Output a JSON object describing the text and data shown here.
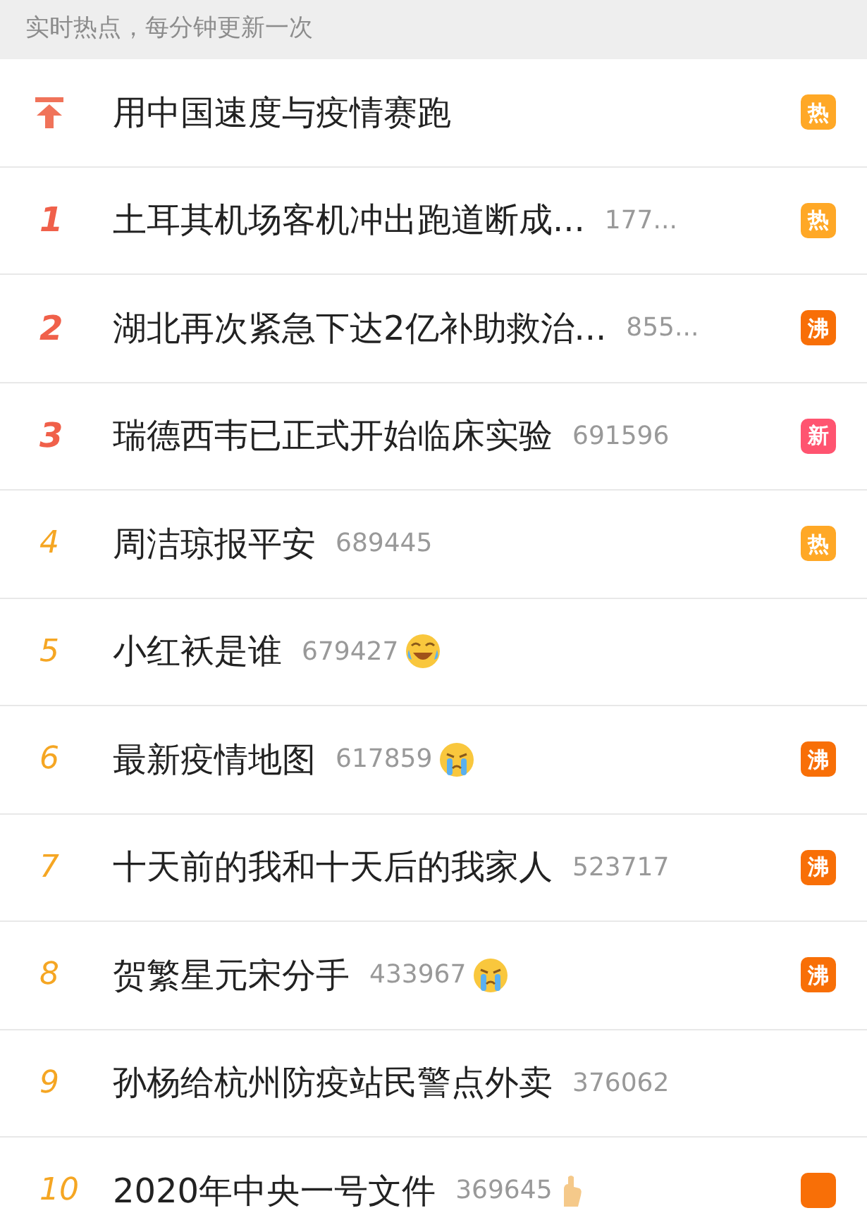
{
  "header": {
    "text": "实时热点，每分钟更新一次"
  },
  "items": [
    {
      "kind": "pinned",
      "title": "用中国速度与疫情赛跑",
      "badge": {
        "label": "热",
        "color": "#ffa826"
      }
    },
    {
      "rank": "1",
      "kind": "top",
      "title": "土耳其机场客机冲出跑道断成...",
      "count": "177...",
      "badge": {
        "label": "热",
        "color": "#ffa826"
      }
    },
    {
      "rank": "2",
      "kind": "top",
      "title": "湖北再次紧急下达2亿补助救治...",
      "count": "855...",
      "badge": {
        "label": "沸",
        "color": "#f86f07"
      }
    },
    {
      "rank": "3",
      "kind": "top",
      "title": "瑞德西韦已正式开始临床实验",
      "count": "691596",
      "badge": {
        "label": "新",
        "color": "#ff5470"
      }
    },
    {
      "rank": "4",
      "kind": "normal",
      "title": "周洁琼报平安",
      "count": "689445",
      "badge": {
        "label": "热",
        "color": "#ffa826"
      }
    },
    {
      "rank": "5",
      "kind": "normal",
      "title": "小红袄是谁",
      "count": "679427",
      "emoji": {
        "kind": "laughcry"
      }
    },
    {
      "rank": "6",
      "kind": "normal",
      "title": "最新疫情地图",
      "count": "617859",
      "emoji": {
        "kind": "crying"
      },
      "badge": {
        "label": "沸",
        "color": "#f86f07"
      }
    },
    {
      "rank": "7",
      "kind": "normal",
      "title": "十天前的我和十天后的我家人",
      "count": "523717",
      "badge": {
        "label": "沸",
        "color": "#f86f07"
      }
    },
    {
      "rank": "8",
      "kind": "normal",
      "title": "贺繁星元宋分手",
      "count": "433967",
      "emoji": {
        "kind": "crying"
      },
      "badge": {
        "label": "沸",
        "color": "#f86f07"
      }
    },
    {
      "rank": "9",
      "kind": "normal",
      "title": "孙杨给杭州防疫站民警点外卖",
      "count": "376062"
    },
    {
      "rank": "10",
      "kind": "normal",
      "title": "2020年中央一号文件",
      "count": "369645",
      "emoji": {
        "kind": "hand"
      },
      "badge": {
        "color": "#f86f07"
      }
    }
  ]
}
